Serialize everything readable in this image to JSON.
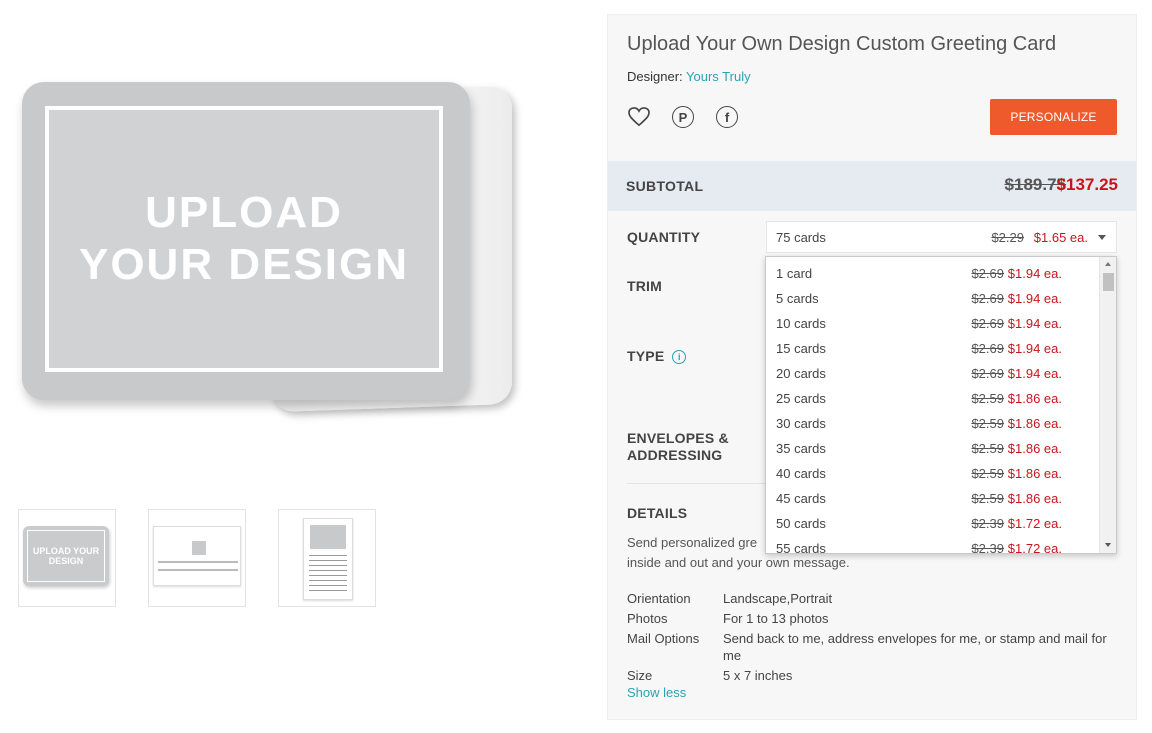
{
  "preview": {
    "card_text": "UPLOAD YOUR DESIGN",
    "thumb1_text": "UPLOAD YOUR DESIGN"
  },
  "product": {
    "title": "Upload Your Own Design Custom Greeting Card",
    "designer_label": "Designer:",
    "designer_name": "Yours Truly",
    "personalize_label": "PERSONALIZE",
    "icons": [
      "heart-icon",
      "pinterest-icon",
      "facebook-icon"
    ]
  },
  "subtotal": {
    "label": "SUBTOTAL",
    "old_price": "$189.75",
    "new_price": "$137.25"
  },
  "options": {
    "quantity_label": "QUANTITY",
    "trim_label": "TRIM",
    "type_label": "TYPE",
    "envelopes_label_line1": "ENVELOPES &",
    "envelopes_label_line2": "ADDRESSING",
    "details_label": "DETAILS"
  },
  "quantity": {
    "selected": "75 cards",
    "old_each": "$2.29",
    "new_each": "$1.65 ea.",
    "items": [
      {
        "name": "1 card",
        "old": "$2.69",
        "new": "$1.94 ea."
      },
      {
        "name": "5 cards",
        "old": "$2.69",
        "new": "$1.94 ea."
      },
      {
        "name": "10 cards",
        "old": "$2.69",
        "new": "$1.94 ea."
      },
      {
        "name": "15 cards",
        "old": "$2.69",
        "new": "$1.94 ea."
      },
      {
        "name": "20 cards",
        "old": "$2.69",
        "new": "$1.94 ea."
      },
      {
        "name": "25 cards",
        "old": "$2.59",
        "new": "$1.86 ea."
      },
      {
        "name": "30 cards",
        "old": "$2.59",
        "new": "$1.86 ea."
      },
      {
        "name": "35 cards",
        "old": "$2.59",
        "new": "$1.86 ea."
      },
      {
        "name": "40 cards",
        "old": "$2.59",
        "new": "$1.86 ea."
      },
      {
        "name": "45 cards",
        "old": "$2.59",
        "new": "$1.86 ea."
      },
      {
        "name": "50 cards",
        "old": "$2.39",
        "new": "$1.72 ea."
      },
      {
        "name": "55 cards",
        "old": "$2.39",
        "new": "$1.72 ea."
      }
    ]
  },
  "details": {
    "description": "Send personalized gre",
    "description_line2": "inside and out and your own message.",
    "specs": [
      {
        "key": "Orientation",
        "value": "Landscape,Portrait"
      },
      {
        "key": "Photos",
        "value": "For 1 to 13 photos"
      },
      {
        "key": "Mail Options",
        "value": "Send back to me, address envelopes for me, or stamp and mail for me"
      },
      {
        "key": "Size",
        "value": "5 x 7 inches"
      }
    ],
    "show_less": "Show less"
  },
  "colors": {
    "accent": "#2aa3b5",
    "cta": "#ef5a2d",
    "sale": "#c7161b",
    "subtotal_bg": "#e6ebf2"
  }
}
